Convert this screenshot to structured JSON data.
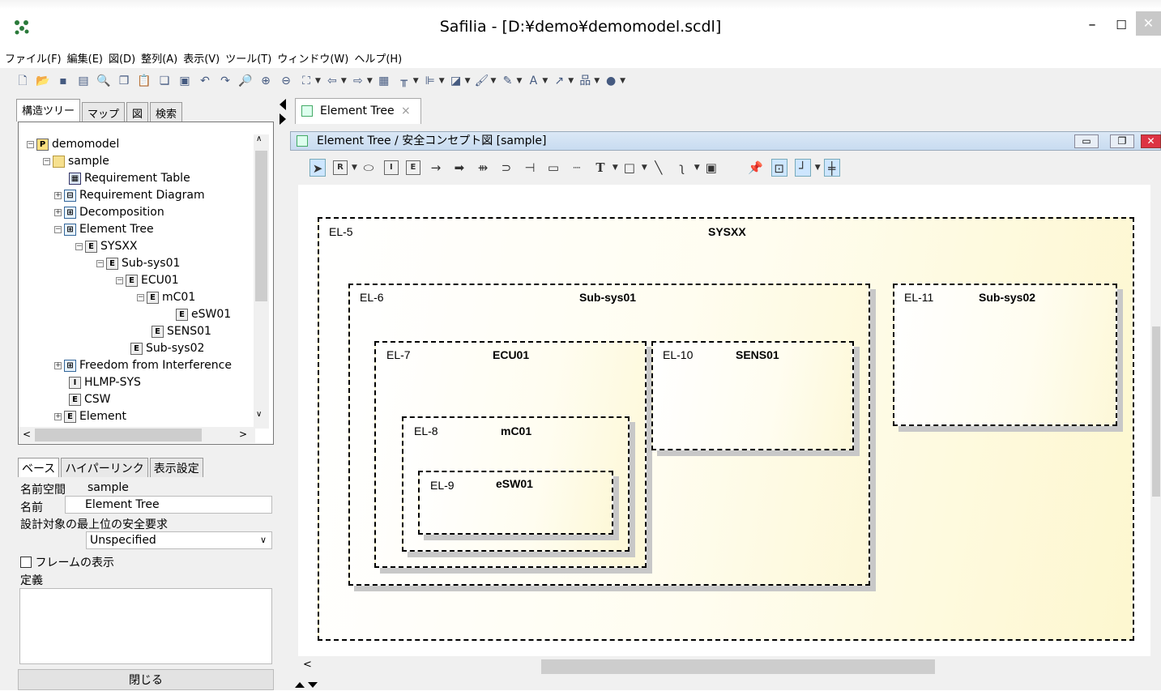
{
  "window": {
    "title": "Safilia - [D:¥demo¥demomodel.scdl]",
    "minimize_icon": "minimize-icon",
    "maximize_icon": "maximize-icon",
    "close_icon": "close-icon"
  },
  "menu": [
    "ファイル(F)",
    "編集(E)",
    "図(D)",
    "整列(A)",
    "表示(V)",
    "ツール(T)",
    "ウィンドウ(W)",
    "ヘルプ(H)"
  ],
  "left_tabs": [
    "構造ツリー",
    "マップ",
    "図",
    "検索"
  ],
  "tree": [
    {
      "label": "demomodel",
      "icon": "P"
    },
    {
      "label": "sample",
      "icon": "folder"
    },
    {
      "label": "Requirement Table",
      "icon": "table"
    },
    {
      "label": "Requirement Diagram",
      "icon": "diagram"
    },
    {
      "label": "Decomposition",
      "icon": "diagram"
    },
    {
      "label": "Element Tree",
      "icon": "diagram"
    },
    {
      "label": "SYSXX",
      "icon": "E"
    },
    {
      "label": "Sub-sys01",
      "icon": "E"
    },
    {
      "label": "ECU01",
      "icon": "E"
    },
    {
      "label": "mC01",
      "icon": "E"
    },
    {
      "label": "eSW01",
      "icon": "E"
    },
    {
      "label": "SENS01",
      "icon": "E"
    },
    {
      "label": "Sub-sys02",
      "icon": "E"
    },
    {
      "label": "Freedom from Interference",
      "icon": "diagram"
    },
    {
      "label": "HLMP-SYS",
      "icon": "I"
    },
    {
      "label": "CSW",
      "icon": "E"
    },
    {
      "label": "Element",
      "icon": "E"
    }
  ],
  "prop_tabs": [
    "ベース",
    "ハイパーリンク",
    "表示設定"
  ],
  "properties": {
    "namespace_label": "名前空間",
    "namespace_value": "sample",
    "name_label": "名前",
    "name_value": "Element Tree",
    "safety_label": "設計対象の最上位の安全要求",
    "safety_value": "Unspecified",
    "frame_label": "フレームの表示",
    "definition_label": "定義",
    "close_button": "閉じる"
  },
  "doc_tab": {
    "label": "Element Tree",
    "close": "×"
  },
  "inner_window": {
    "title": "Element Tree / 安全コンセプト図 [sample]"
  },
  "diagram": {
    "elements": [
      {
        "id": "EL-5",
        "name": "SYSXX"
      },
      {
        "id": "EL-6",
        "name": "Sub-sys01"
      },
      {
        "id": "EL-11",
        "name": "Sub-sys02"
      },
      {
        "id": "EL-7",
        "name": "ECU01"
      },
      {
        "id": "EL-10",
        "name": "SENS01"
      },
      {
        "id": "EL-8",
        "name": "mC01"
      },
      {
        "id": "EL-9",
        "name": "eSW01"
      }
    ]
  },
  "colors": {
    "canvas_fill_start": "#ffffff",
    "canvas_fill_end": "#fdf7cf",
    "inner_title_bg": "#c8dbf0"
  }
}
